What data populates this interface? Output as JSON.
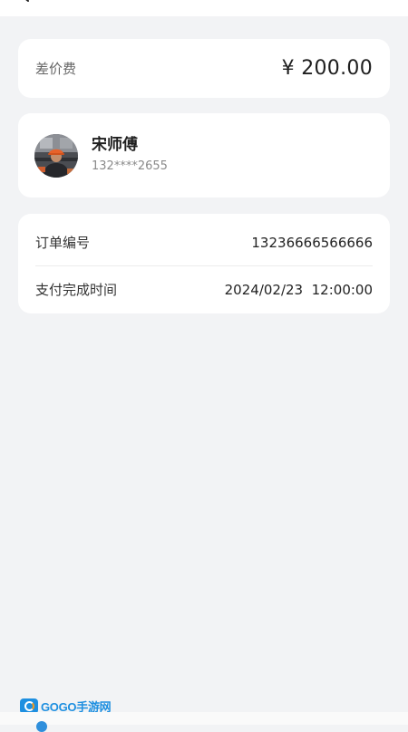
{
  "header": {
    "back_icon": "chevron-left-icon"
  },
  "price_card": {
    "label": "差价费",
    "amount": "¥ 200.00"
  },
  "worker": {
    "name": "宋师傅",
    "phone": "132****2655",
    "avatar_icon": "worker-avatar"
  },
  "order": {
    "rows": [
      {
        "label": "订单编号",
        "value": "13236666566666"
      },
      {
        "label": "支付完成时间",
        "value": "2024/02/23  12:00:00"
      }
    ]
  },
  "watermark": {
    "text": "GOGO手游网"
  },
  "colors": {
    "background": "#f2f3f5",
    "card": "#ffffff",
    "label_gray": "#666666",
    "brand_blue": "#1e8fe0",
    "hardhat_orange": "#e8622a"
  }
}
